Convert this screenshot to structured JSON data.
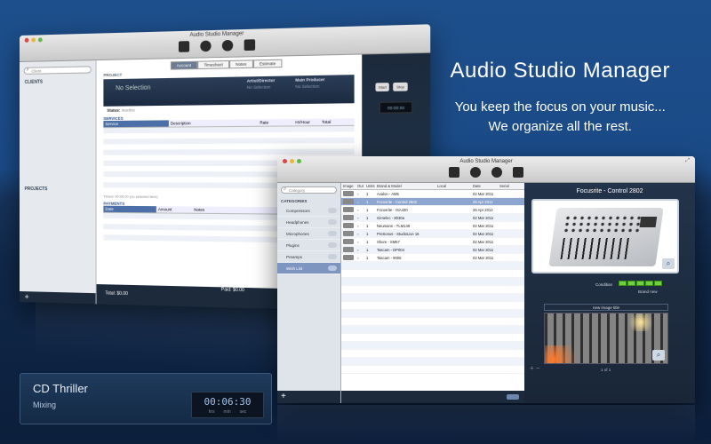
{
  "promo": {
    "title": "Audio Studio Manager",
    "line1": "You keep the focus on your music...",
    "line2": "We organize all the rest."
  },
  "back_window": {
    "title": "Audio Studio Manager",
    "search_placeholder": "Client",
    "clients_label": "CLIENTS",
    "projects_label": "PROJECTS",
    "add_symbol": "+",
    "tabs": [
      {
        "label": "Account"
      },
      {
        "label": "Timesheet"
      },
      {
        "label": "Notes"
      },
      {
        "label": "Estimate"
      }
    ],
    "project_label": "PROJECT",
    "no_selection": "No Selection",
    "artist_label": "Artist/Director",
    "artist_value": "No Selection",
    "producer_label": "Main Producer",
    "producer_value": "No Selection",
    "status_label": "Status:",
    "status_value": "Inactive",
    "services_label": "SERVICES",
    "services_columns": [
      "Service",
      "Description",
      "Rate",
      "Hr/Hour",
      "Total"
    ],
    "services_footer": "Timed: 00:00:00 (no selected item)",
    "payments_label": "PAYMENTS",
    "payments_columns": [
      "Date",
      "Amount",
      "Notes"
    ],
    "total_label": "Total: $0.00",
    "paid_label": "Paid: $0.00",
    "start_button": "Start",
    "stop_button": "Stop",
    "timer": "00:00:00"
  },
  "front_window": {
    "title": "Audio Studio Manager",
    "search_placeholder": "Category",
    "categories_label": "CATEGORIES",
    "categories": [
      {
        "label": "Compressors",
        "selected": false
      },
      {
        "label": "Headphones",
        "selected": false
      },
      {
        "label": "Microphones",
        "selected": false
      },
      {
        "label": "Plugins",
        "selected": false
      },
      {
        "label": "Preamps",
        "selected": false
      },
      {
        "label": "Wish List",
        "selected": true
      }
    ],
    "add_symbol": "+",
    "columns": [
      "Image",
      "Out",
      "Units",
      "Brand & Model",
      "Local",
      "Date",
      "Serial"
    ],
    "rows": [
      {
        "units": "1",
        "brand": "Avalon - AM5",
        "date": "02 Mar 2011",
        "selected": false
      },
      {
        "units": "1",
        "brand": "Focusrite - Control 2802",
        "date": "26 Apr 2012",
        "selected": true
      },
      {
        "units": "1",
        "brand": "Focusrite - ISA430",
        "date": "26 Apr 2012",
        "selected": false
      },
      {
        "units": "1",
        "brand": "Genelec - 8030a",
        "date": "02 Mar 2011",
        "selected": false
      },
      {
        "units": "1",
        "brand": "Neumann - TLM149",
        "date": "02 Mar 2011",
        "selected": false
      },
      {
        "units": "1",
        "brand": "PreSonus - StudioLive 16",
        "date": "02 Mar 2011",
        "selected": false
      },
      {
        "units": "1",
        "brand": "Shure - SM57",
        "date": "02 Mar 2011",
        "selected": false
      },
      {
        "units": "1",
        "brand": "Tascam - DP004",
        "date": "02 Mar 2011",
        "selected": false
      },
      {
        "units": "1",
        "brand": "Tascam - 9005",
        "date": "02 Mar 2011",
        "selected": false
      }
    ],
    "detail": {
      "name": "Focusrite - Control 2802",
      "condition_label": "Condition",
      "condition_value": "Brand new",
      "condition_level": 5,
      "image_title": "new image title",
      "page_indicator": "1 of 1",
      "photo_controls": "+ −"
    }
  },
  "cd_widget": {
    "name": "CD Thriller",
    "stage": "Mixing",
    "time": "00:06:30",
    "units": [
      "hrs",
      "min",
      "sec"
    ]
  }
}
